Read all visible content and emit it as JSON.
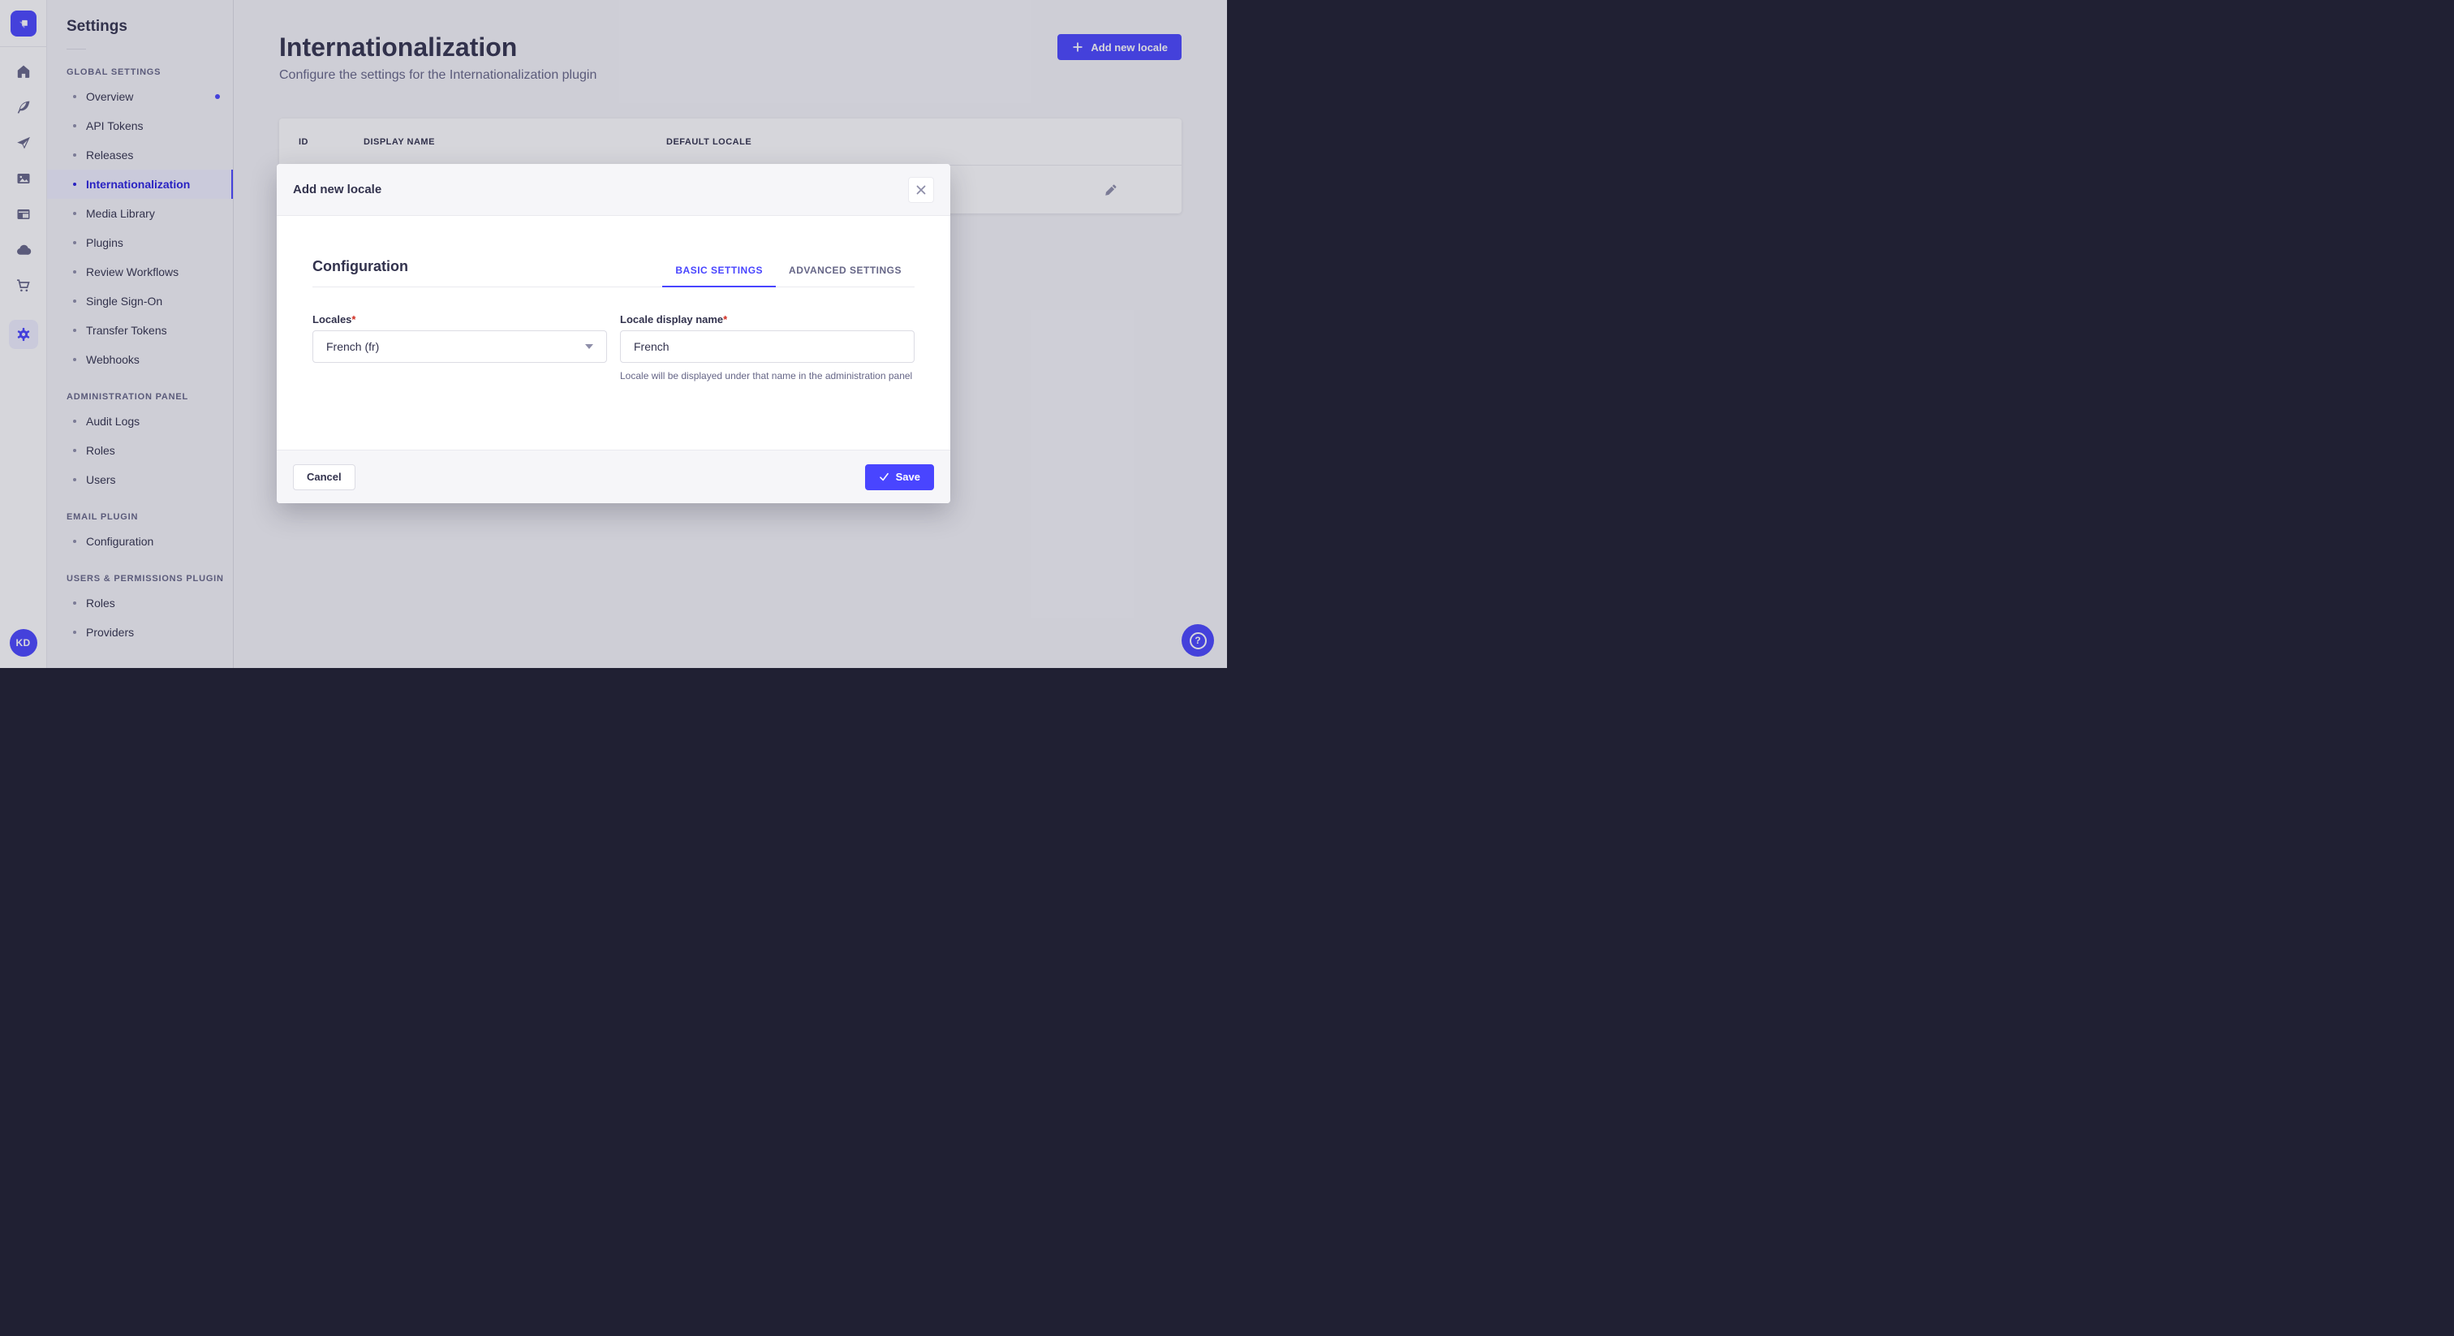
{
  "colors": {
    "primary": "#4945ff",
    "primary_active_text": "#271fe0",
    "primary_tile_bg": "#f0f0ff",
    "neutral_text": "#32324d",
    "muted_text": "#666687",
    "icon_gray": "#8e8ea9",
    "danger": "#d02b20",
    "surface": "#f6f6f9",
    "overlay": "rgba(50,50,77,0.2)"
  },
  "nav_rail": {
    "logo": "strapi-logo",
    "icons": [
      "home",
      "content-manager",
      "paper-plane",
      "media-library",
      "content-type-builder",
      "cloud",
      "marketplace",
      "settings"
    ],
    "user_initials": "KD"
  },
  "sidebar": {
    "title": "Settings",
    "sections": [
      {
        "label": "GLOBAL SETTINGS",
        "items": [
          {
            "label": "Overview",
            "has_notification": true
          },
          {
            "label": "API Tokens"
          },
          {
            "label": "Releases"
          },
          {
            "label": "Internationalization",
            "active": true
          },
          {
            "label": "Media Library"
          },
          {
            "label": "Plugins"
          },
          {
            "label": "Review Workflows"
          },
          {
            "label": "Single Sign-On"
          },
          {
            "label": "Transfer Tokens"
          },
          {
            "label": "Webhooks"
          }
        ]
      },
      {
        "label": "ADMINISTRATION PANEL",
        "items": [
          {
            "label": "Audit Logs"
          },
          {
            "label": "Roles"
          },
          {
            "label": "Users"
          }
        ]
      },
      {
        "label": "EMAIL PLUGIN",
        "items": [
          {
            "label": "Configuration"
          }
        ]
      },
      {
        "label": "USERS & PERMISSIONS PLUGIN",
        "items": [
          {
            "label": "Roles"
          },
          {
            "label": "Providers"
          }
        ]
      }
    ]
  },
  "header": {
    "title": "Internationalization",
    "subtitle": "Configure the settings for the Internationalization plugin",
    "add_button_label": "Add new locale"
  },
  "table": {
    "columns": [
      "ID",
      "DISPLAY NAME",
      "DEFAULT LOCALE"
    ]
  },
  "modal": {
    "title": "Add new locale",
    "section_title": "Configuration",
    "tabs": [
      {
        "label": "BASIC SETTINGS",
        "active": true
      },
      {
        "label": "ADVANCED SETTINGS",
        "active": false
      }
    ],
    "fields": {
      "locales": {
        "label": "Locales",
        "required_mark": "*",
        "value": "French (fr)"
      },
      "display_name": {
        "label": "Locale display name",
        "required_mark": "*",
        "value": "French",
        "helper": "Locale will be displayed under that name in the administration panel"
      }
    },
    "cancel_label": "Cancel",
    "save_label": "Save"
  },
  "help_button": {
    "glyph": "?"
  }
}
